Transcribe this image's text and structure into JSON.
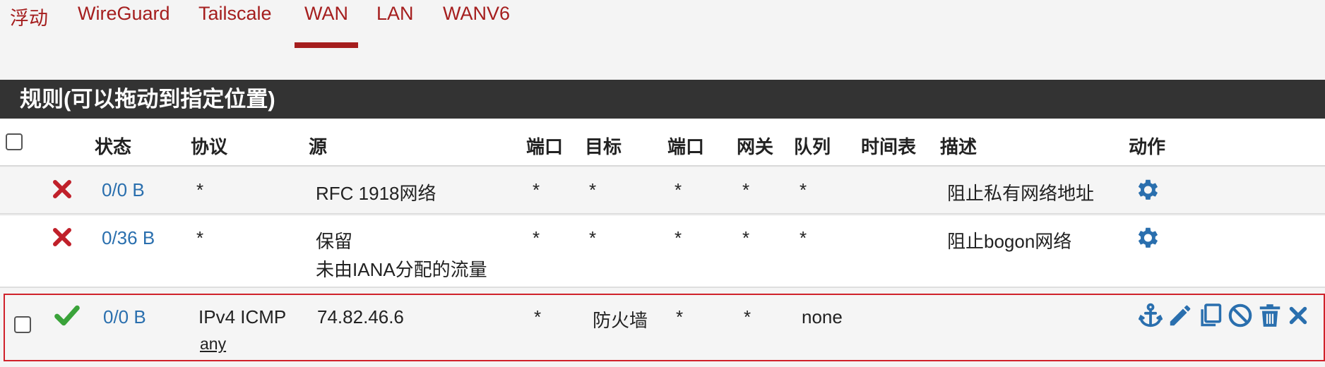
{
  "tabs": [
    {
      "label": "浮动"
    },
    {
      "label": "WireGuard"
    },
    {
      "label": "Tailscale"
    },
    {
      "label": "WAN",
      "active": true
    },
    {
      "label": "LAN"
    },
    {
      "label": "WANV6"
    }
  ],
  "panel": {
    "title": "规则(可以拖动到指定位置)"
  },
  "columns": {
    "state": "状态",
    "protocol": "协议",
    "source": "源",
    "source_port": "端口",
    "destination": "目标",
    "dest_port": "端口",
    "gateway": "网关",
    "queue": "队列",
    "schedule": "时间表",
    "description": "描述",
    "actions": "动作"
  },
  "rows": [
    {
      "status": "block",
      "states": "0/0 B",
      "protocol": "*",
      "source": "RFC 1918网络",
      "source_port": "*",
      "destination": "*",
      "dest_port": "*",
      "gateway": "*",
      "queue": "*",
      "schedule": "",
      "description": "阻止私有网络地址"
    },
    {
      "status": "block",
      "states": "0/36 B",
      "protocol": "*",
      "source": "保留",
      "source_sub": "未由IANA分配的流量",
      "source_port": "*",
      "destination": "*",
      "dest_port": "*",
      "gateway": "*",
      "queue": "*",
      "schedule": "",
      "description": "阻止bogon网络"
    },
    {
      "status": "pass",
      "states": "0/0 B",
      "protocol": "IPv4 ICMP",
      "protocol_sub": "any",
      "source": "74.82.46.6",
      "source_port": "*",
      "destination": "防火墙",
      "dest_port": "*",
      "gateway": "*",
      "queue": "none",
      "schedule": "",
      "description": ""
    }
  ],
  "colors": {
    "accent": "#a51e1e",
    "link": "#2a6fae",
    "block": "#c0202a",
    "pass": "#3aa33a",
    "header_bar": "#333333",
    "selected_border": "#d0222b"
  },
  "icons": {
    "block": "x-icon",
    "pass": "check-icon",
    "settings": "gear-icon",
    "actions": [
      "anchor-icon",
      "pencil-icon",
      "copy-icon",
      "disable-icon",
      "trash-icon",
      "delete-x-icon"
    ]
  }
}
